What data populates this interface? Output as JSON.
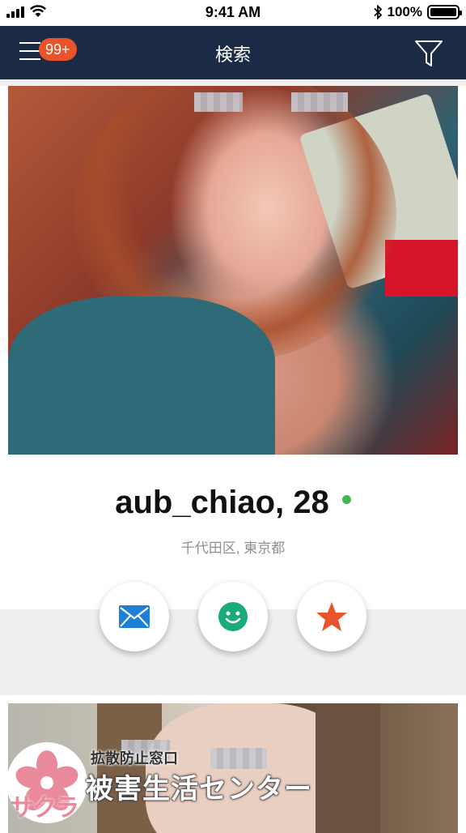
{
  "status_bar": {
    "time": "9:41 AM",
    "battery": "100%",
    "icons": [
      "signal-icon",
      "wifi-icon",
      "bluetooth-icon",
      "battery-icon"
    ]
  },
  "nav": {
    "title": "検索",
    "badge": "99+",
    "icons": [
      "menu-icon",
      "filter-icon"
    ],
    "color": "#1b2b45",
    "badge_color": "#e8532a"
  },
  "profile": {
    "username": "aub_chiao, 28",
    "location": "千代田区, 東京都",
    "online_color": "#3bbb4b",
    "actions": [
      {
        "name": "message",
        "icon": "mail-icon",
        "color": "#1e7fd6"
      },
      {
        "name": "smile",
        "icon": "smile-icon",
        "color": "#1bab7a"
      },
      {
        "name": "favorite",
        "icon": "star-icon",
        "color": "#e8532a"
      }
    ]
  },
  "watermark": {
    "kana": "サクラ",
    "small": "拡散防止窓口",
    "big": "被害生活センター",
    "color": "#e88a9c"
  }
}
